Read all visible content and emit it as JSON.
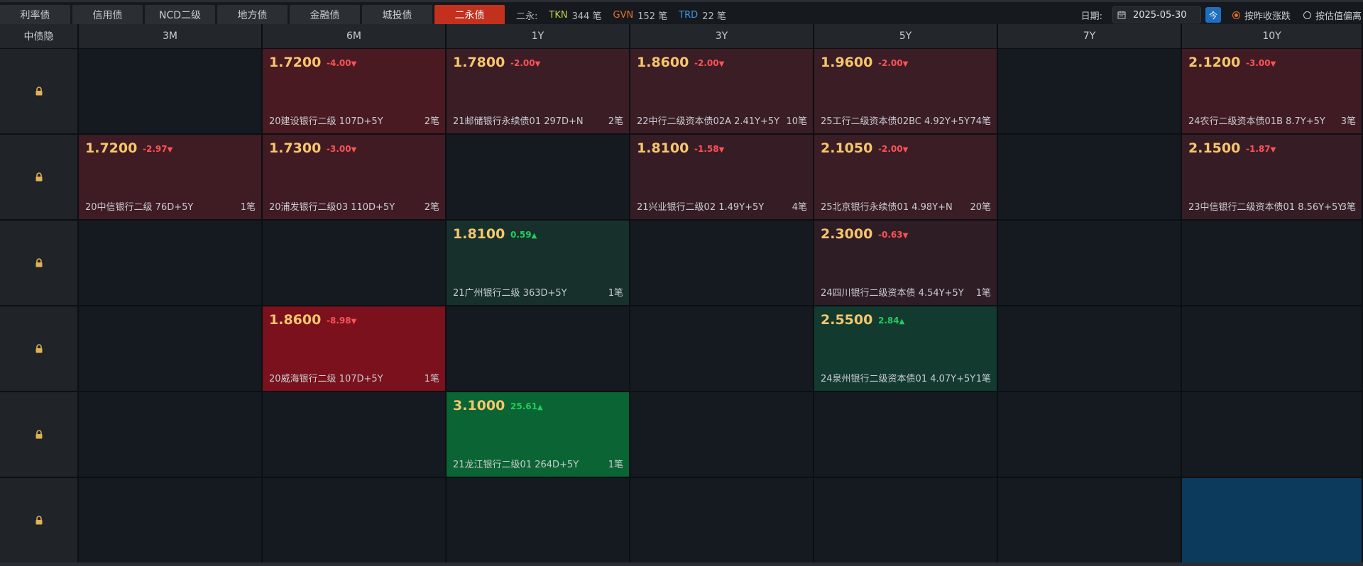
{
  "tabs": [
    {
      "label": "利率债",
      "active": false
    },
    {
      "label": "信用债",
      "active": false
    },
    {
      "label": "NCD二级",
      "active": false
    },
    {
      "label": "地方债",
      "active": false
    },
    {
      "label": "金融债",
      "active": false
    },
    {
      "label": "城投债",
      "active": false
    },
    {
      "label": "二永债",
      "active": true
    }
  ],
  "summary": {
    "prefix": "二永:",
    "items": [
      {
        "code": "TKN",
        "count": "344 笔",
        "color": "#c2d44a"
      },
      {
        "code": "GVN",
        "count": "152 笔",
        "color": "#e8702a"
      },
      {
        "code": "TRD",
        "count": "22 笔",
        "color": "#3f9be8"
      }
    ]
  },
  "controls": {
    "date_label": "日期:",
    "date_value": "2025-05-30",
    "calendar_icon": "calendar-icon",
    "today_label": "今",
    "radio_options": [
      {
        "label": "按昨收涨跌",
        "checked": true
      },
      {
        "label": "按估值偏离",
        "checked": false
      }
    ]
  },
  "grid": {
    "corner_label": "中债隐",
    "columns": [
      "3M",
      "6M",
      "1Y",
      "3Y",
      "5Y",
      "7Y",
      "10Y"
    ],
    "lock_icon": "lock-icon",
    "rows": [
      [
        null,
        {
          "price": "1.7200",
          "change": "-4.00",
          "dir": "down",
          "bond": "20建设银行二级 107D+5Y",
          "count": "2笔",
          "bg": "#4a1a22"
        },
        {
          "price": "1.7800",
          "change": "-2.00",
          "dir": "down",
          "bond": "21邮储银行永续债01 297D+N",
          "count": "2笔",
          "bg": "#3a1d25"
        },
        {
          "price": "1.8600",
          "change": "-2.00",
          "dir": "down",
          "bond": "22中行二级资本债02A 2.41Y+5Y",
          "count": "10笔",
          "bg": "#3a1d25"
        },
        {
          "price": "1.9600",
          "change": "-2.00",
          "dir": "down",
          "bond": "25工行二级资本债02BC 4.92Y+5Y",
          "count": "74笔",
          "bg": "#3a1d25"
        },
        null,
        {
          "price": "2.1200",
          "change": "-3.00",
          "dir": "down",
          "bond": "24农行二级资本债01B 8.7Y+5Y",
          "count": "3笔",
          "bg": "#401b23"
        }
      ],
      [
        {
          "price": "1.7200",
          "change": "-2.97",
          "dir": "down",
          "bond": "20中信银行二级 76D+5Y",
          "count": "1笔",
          "bg": "#3f1b23"
        },
        {
          "price": "1.7300",
          "change": "-3.00",
          "dir": "down",
          "bond": "20浦发银行二级03 110D+5Y",
          "count": "2笔",
          "bg": "#401b23"
        },
        null,
        {
          "price": "1.8100",
          "change": "-1.58",
          "dir": "down",
          "bond": "21兴业银行二级02 1.49Y+5Y",
          "count": "4笔",
          "bg": "#361d25"
        },
        {
          "price": "2.1050",
          "change": "-2.00",
          "dir": "down",
          "bond": "25北京银行永续债01 4.98Y+N",
          "count": "20笔",
          "bg": "#3a1d25"
        },
        null,
        {
          "price": "2.1500",
          "change": "-1.87",
          "dir": "down",
          "bond": "23中信银行二级资本债01 8.56Y+5Y",
          "count": "3笔",
          "bg": "#361d25"
        }
      ],
      [
        null,
        null,
        {
          "price": "1.8100",
          "change": "0.59",
          "dir": "up",
          "bond": "21广州银行二级 363D+5Y",
          "count": "1笔",
          "bg": "#17302b"
        },
        null,
        {
          "price": "2.3000",
          "change": "-0.63",
          "dir": "down",
          "bond": "24四川银行二级资本债 4.54Y+5Y",
          "count": "1笔",
          "bg": "#2e1d25"
        },
        null,
        null
      ],
      [
        null,
        {
          "price": "1.8600",
          "change": "-8.98",
          "dir": "down",
          "bond": "20威海银行二级 107D+5Y",
          "count": "1笔",
          "bg": "#7a111d"
        },
        null,
        null,
        {
          "price": "2.5500",
          "change": "2.84",
          "dir": "up",
          "bond": "24泉州银行二级资本债01 4.07Y+5Y",
          "count": "1笔",
          "bg": "#123a2e"
        },
        null,
        null
      ],
      [
        null,
        null,
        {
          "price": "3.1000",
          "change": "25.61",
          "dir": "up",
          "bond": "21龙江银行二级01 264D+5Y",
          "count": "1笔",
          "bg": "#0b6433"
        },
        null,
        null,
        null,
        null
      ],
      [
        null,
        null,
        null,
        null,
        null,
        null,
        {
          "price": "",
          "change": "",
          "dir": "",
          "bond": "",
          "count": "",
          "bg": "#0b3a5c"
        }
      ]
    ]
  }
}
